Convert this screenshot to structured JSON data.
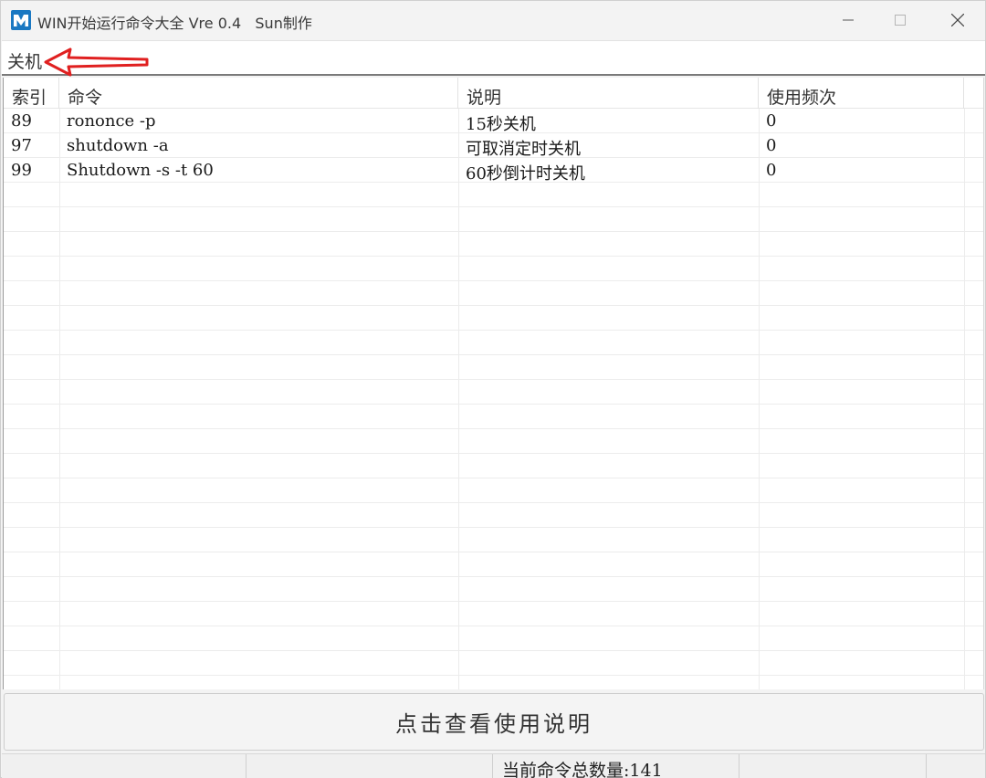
{
  "window": {
    "title": "WIN开始运行命令大全 Vre 0.4   Sun制作"
  },
  "search": {
    "value": "关机"
  },
  "table": {
    "columns": [
      "索引",
      "命令",
      "说明",
      "使用频次"
    ],
    "rows": [
      {
        "index": "89",
        "command": "rononce -p",
        "description": "15秒关机",
        "frequency": "0"
      },
      {
        "index": "97",
        "command": "shutdown -a",
        "description": "可取消定时关机",
        "frequency": "0"
      },
      {
        "index": "99",
        "command": "Shutdown -s -t 60",
        "description": "60秒倒计时关机",
        "frequency": "0"
      }
    ]
  },
  "help_button": {
    "label": "点击查看使用说明"
  },
  "status_bar": {
    "count_text": "当前命令总数量:141"
  },
  "colors": {
    "app_icon": "#1a78c2",
    "annotation_arrow": "#e02020"
  },
  "icons": {
    "app": "app-m-logo-icon",
    "minimize": "minimize-icon",
    "maximize": "maximize-icon",
    "close": "close-icon",
    "annotation": "red-arrow-icon"
  }
}
